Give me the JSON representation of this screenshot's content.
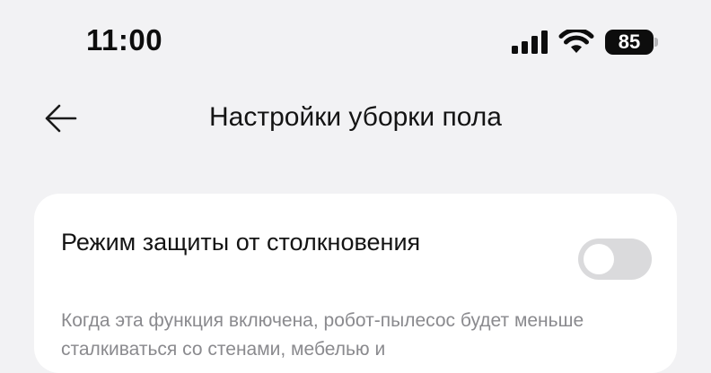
{
  "status_bar": {
    "time": "11:00",
    "battery_level": "85",
    "icons": [
      "cellular-signal-icon",
      "wifi-icon",
      "battery-icon"
    ]
  },
  "nav": {
    "back_icon": "arrow-left-icon",
    "title": "Настройки уборки пола"
  },
  "setting": {
    "title": "Режим защиты от столкновения",
    "toggle_on": false,
    "description": "Когда эта функция включена, робот-пылесос будет меньше сталкиваться со стенами, мебелью и"
  },
  "colors": {
    "background": "#f2f2f4",
    "card": "#ffffff",
    "toggle_off": "#dadadc",
    "description_text": "#8a8a8e"
  }
}
